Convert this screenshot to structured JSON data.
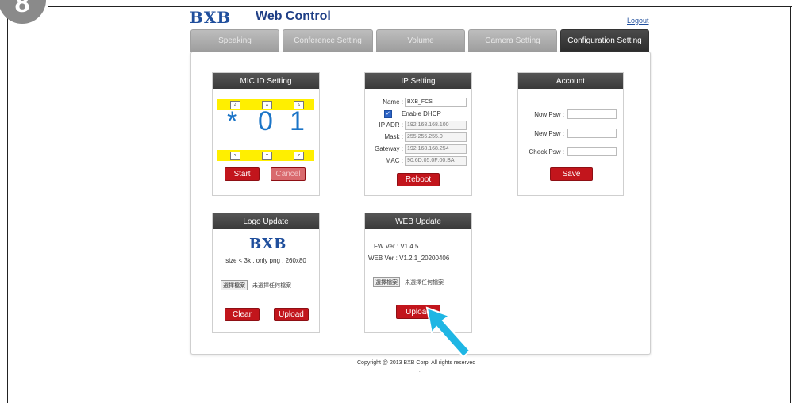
{
  "step_badge": "8",
  "header": {
    "logo": "BXB",
    "title": "Web Control",
    "logout": "Logout"
  },
  "tabs": [
    {
      "label": "Speaking",
      "active": false
    },
    {
      "label": "Conference Setting",
      "active": false
    },
    {
      "label": "Volume",
      "active": false
    },
    {
      "label": "Camera Setting",
      "active": false
    },
    {
      "label": "Configuration Setting",
      "active": true
    }
  ],
  "mic": {
    "title": "MIC ID Setting",
    "up": "▵",
    "down": "▿",
    "digits": [
      "*",
      "0",
      "1"
    ],
    "start": "Start",
    "cancel": "Cancel"
  },
  "ip": {
    "title": "IP Setting",
    "name_label": "Name :",
    "name_value": "BXB_FCS",
    "dhcp_label": "Enable DHCP",
    "dhcp_checked": true,
    "ip_label": "IP ADR :",
    "ip_value": "192.168.168.100",
    "mask_label": "Mask :",
    "mask_value": "255.255.255.0",
    "gateway_label": "Gateway :",
    "gateway_value": "192.168.168.254",
    "mac_label": "MAC :",
    "mac_value": "90:6D:05:0F:00:BA",
    "reboot": "Reboot"
  },
  "account": {
    "title": "Account",
    "now_label": "Now Psw :",
    "new_label": "New Psw :",
    "check_label": "Check Psw :",
    "now_value": "",
    "new_value": "",
    "check_value": "",
    "save": "Save"
  },
  "logo_update": {
    "title": "Logo Update",
    "logo": "BXB",
    "hint": "size < 3k , only png , 260x80",
    "choose_btn": "選擇檔案",
    "file_status": "未選擇任何檔案",
    "clear": "Clear",
    "upload": "Upload"
  },
  "web_update": {
    "title": "WEB Update",
    "fw": "FW Ver : V1.4.5",
    "web": "WEB Ver : V1.2.1_20200406",
    "choose_btn": "選擇檔案",
    "file_status": "未選擇任何檔案",
    "upload": "Upload"
  },
  "footer": {
    "copyright": "Copyright @ 2013 BXB Corp. All rights reserved",
    "dot": "."
  },
  "colors": {
    "accent_red": "#c2151c",
    "highlight_yellow": "#ffef00",
    "digit_blue": "#1a74c7",
    "pointer_cyan": "#1fb6e4"
  }
}
